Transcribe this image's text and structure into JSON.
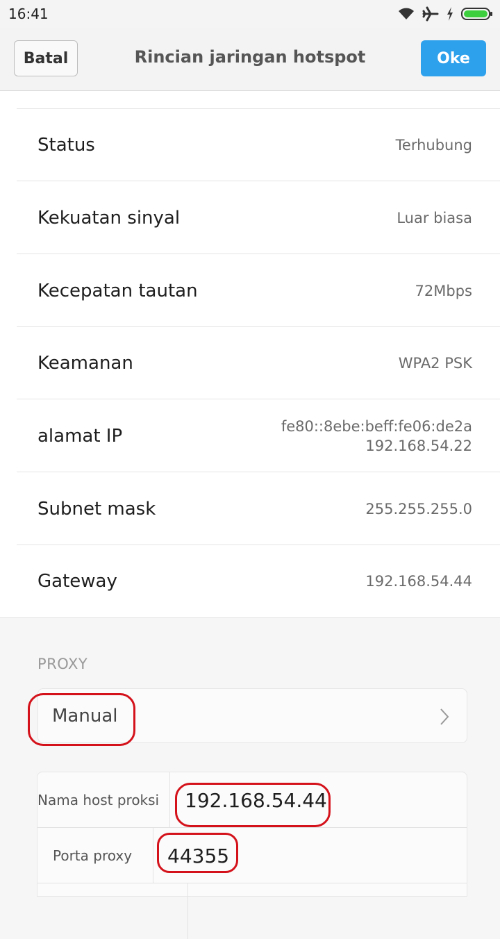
{
  "status_bar": {
    "time": "16:41",
    "icons": [
      "wifi-icon",
      "airplane-icon",
      "charging-icon",
      "battery-icon"
    ]
  },
  "header": {
    "cancel_label": "Batal",
    "title": "Rincian jaringan hotspot",
    "ok_label": "Oke"
  },
  "details": [
    {
      "label": "Status",
      "value": "Terhubung"
    },
    {
      "label": "Kekuatan sinyal",
      "value": "Luar biasa"
    },
    {
      "label": "Kecepatan tautan",
      "value": "72Mbps"
    },
    {
      "label": "Keamanan",
      "value": "WPA2 PSK"
    },
    {
      "label": "alamat IP",
      "value_line1": "fe80::8ebe:beff:fe06:de2a",
      "value_line2": "192.168.54.22"
    },
    {
      "label": "Subnet mask",
      "value": "255.255.255.0"
    },
    {
      "label": "Gateway",
      "value": "192.168.54.44"
    }
  ],
  "proxy": {
    "section_label": "PROXY",
    "mode": "Manual",
    "host_label": "Nama host proksi",
    "host_value": "192.168.54.44",
    "port_label": "Porta proxy",
    "port_value": "44355"
  },
  "colors": {
    "accent": "#2ea1ec",
    "annotation": "#d4121b",
    "battery": "#3ecf3e"
  }
}
